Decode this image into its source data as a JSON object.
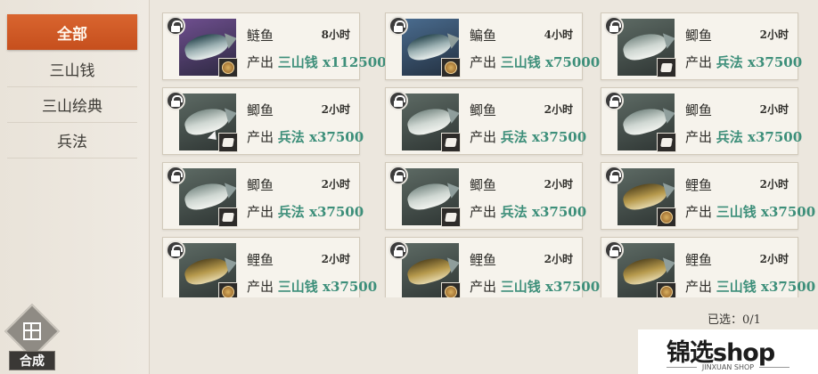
{
  "sidebar": {
    "items": [
      {
        "label": "全部",
        "active": true
      },
      {
        "label": "三山钱",
        "active": false
      },
      {
        "label": "三山绘典",
        "active": false
      },
      {
        "label": "兵法",
        "active": false
      }
    ]
  },
  "combine": {
    "label": "合成",
    "icon": "grid-icon"
  },
  "cards": [
    {
      "name": "鲢鱼",
      "time": "8小时",
      "produce_label": "产出",
      "resource": "三山钱 x112500",
      "rarity": "purple",
      "badge": "coin"
    },
    {
      "name": "鳊鱼",
      "time": "4小时",
      "produce_label": "产出",
      "resource": "三山钱 x75000",
      "rarity": "blue",
      "badge": "coin"
    },
    {
      "name": "鲫鱼",
      "time": "2小时",
      "produce_label": "产出",
      "resource": "兵法 x37500",
      "rarity": "normal",
      "badge": "book"
    },
    {
      "name": "鲫鱼",
      "time": "2小时",
      "produce_label": "产出",
      "resource": "兵法 x37500",
      "rarity": "normal",
      "badge": "book"
    },
    {
      "name": "鲫鱼",
      "time": "2小时",
      "produce_label": "产出",
      "resource": "兵法 x37500",
      "rarity": "normal",
      "badge": "book"
    },
    {
      "name": "鲫鱼",
      "time": "2小时",
      "produce_label": "产出",
      "resource": "兵法 x37500",
      "rarity": "normal",
      "badge": "book"
    },
    {
      "name": "鲫鱼",
      "time": "2小时",
      "produce_label": "产出",
      "resource": "兵法 x37500",
      "rarity": "normal",
      "badge": "book"
    },
    {
      "name": "鲫鱼",
      "time": "2小时",
      "produce_label": "产出",
      "resource": "兵法 x37500",
      "rarity": "normal",
      "badge": "book"
    },
    {
      "name": "鲤鱼",
      "time": "2小时",
      "produce_label": "产出",
      "resource": "三山钱 x37500",
      "rarity": "normal",
      "badge": "coin"
    },
    {
      "name": "鲤鱼",
      "time": "2小时",
      "produce_label": "产出",
      "resource": "三山钱 x37500",
      "rarity": "normal",
      "badge": "coin"
    },
    {
      "name": "鲤鱼",
      "time": "2小时",
      "produce_label": "产出",
      "resource": "三山钱 x37500",
      "rarity": "normal",
      "badge": "coin"
    },
    {
      "name": "鲤鱼",
      "time": "2小时",
      "produce_label": "产出",
      "resource": "三山钱 x37500",
      "rarity": "normal",
      "badge": "coin"
    }
  ],
  "selection": {
    "label": "已选：",
    "value": "0/1"
  },
  "watermark": {
    "brand": "锦选shop",
    "sub": "JINXUAN SHOP"
  },
  "colors": {
    "accent": "#d25a27",
    "resource": "#3d8f7a"
  }
}
